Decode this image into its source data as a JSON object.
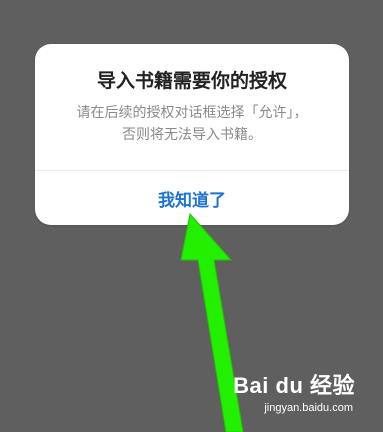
{
  "dialog": {
    "title": "导入书籍需要你的授权",
    "message_line_1": "请在后续的授权对话框选择「允许」，",
    "message_line_2": "否则将无法导入书籍。",
    "button_label": "我知道了"
  },
  "watermark": {
    "brand": "Bai du 经验",
    "domain": "jingyan.baidu.com"
  },
  "colors": {
    "background": "#5f5f5f",
    "dialog": "#ffffff",
    "button_text": "#1f73d1",
    "arrow": "#22f000"
  },
  "icons": {
    "arrow": "pointing-arrow-icon"
  }
}
